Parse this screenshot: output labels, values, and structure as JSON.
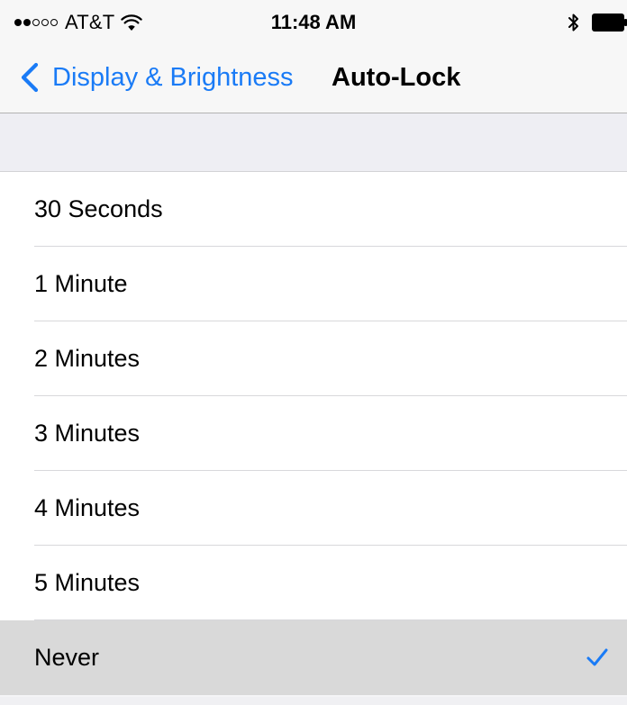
{
  "status_bar": {
    "carrier": "AT&T",
    "time": "11:48 AM",
    "signal_bars_filled": 2,
    "signal_bars_total": 5,
    "icons": [
      "wifi-icon",
      "bluetooth-icon",
      "battery-icon"
    ]
  },
  "nav": {
    "back_label": "Display & Brightness",
    "title": "Auto-Lock"
  },
  "options": [
    {
      "label": "30 Seconds",
      "selected": false
    },
    {
      "label": "1 Minute",
      "selected": false
    },
    {
      "label": "2 Minutes",
      "selected": false
    },
    {
      "label": "3 Minutes",
      "selected": false
    },
    {
      "label": "4 Minutes",
      "selected": false
    },
    {
      "label": "5 Minutes",
      "selected": false
    },
    {
      "label": "Never",
      "selected": true
    }
  ],
  "colors": {
    "accent": "#1a7bf6",
    "selected_row": "#d9d9d9",
    "group_background": "#eeeef3"
  }
}
